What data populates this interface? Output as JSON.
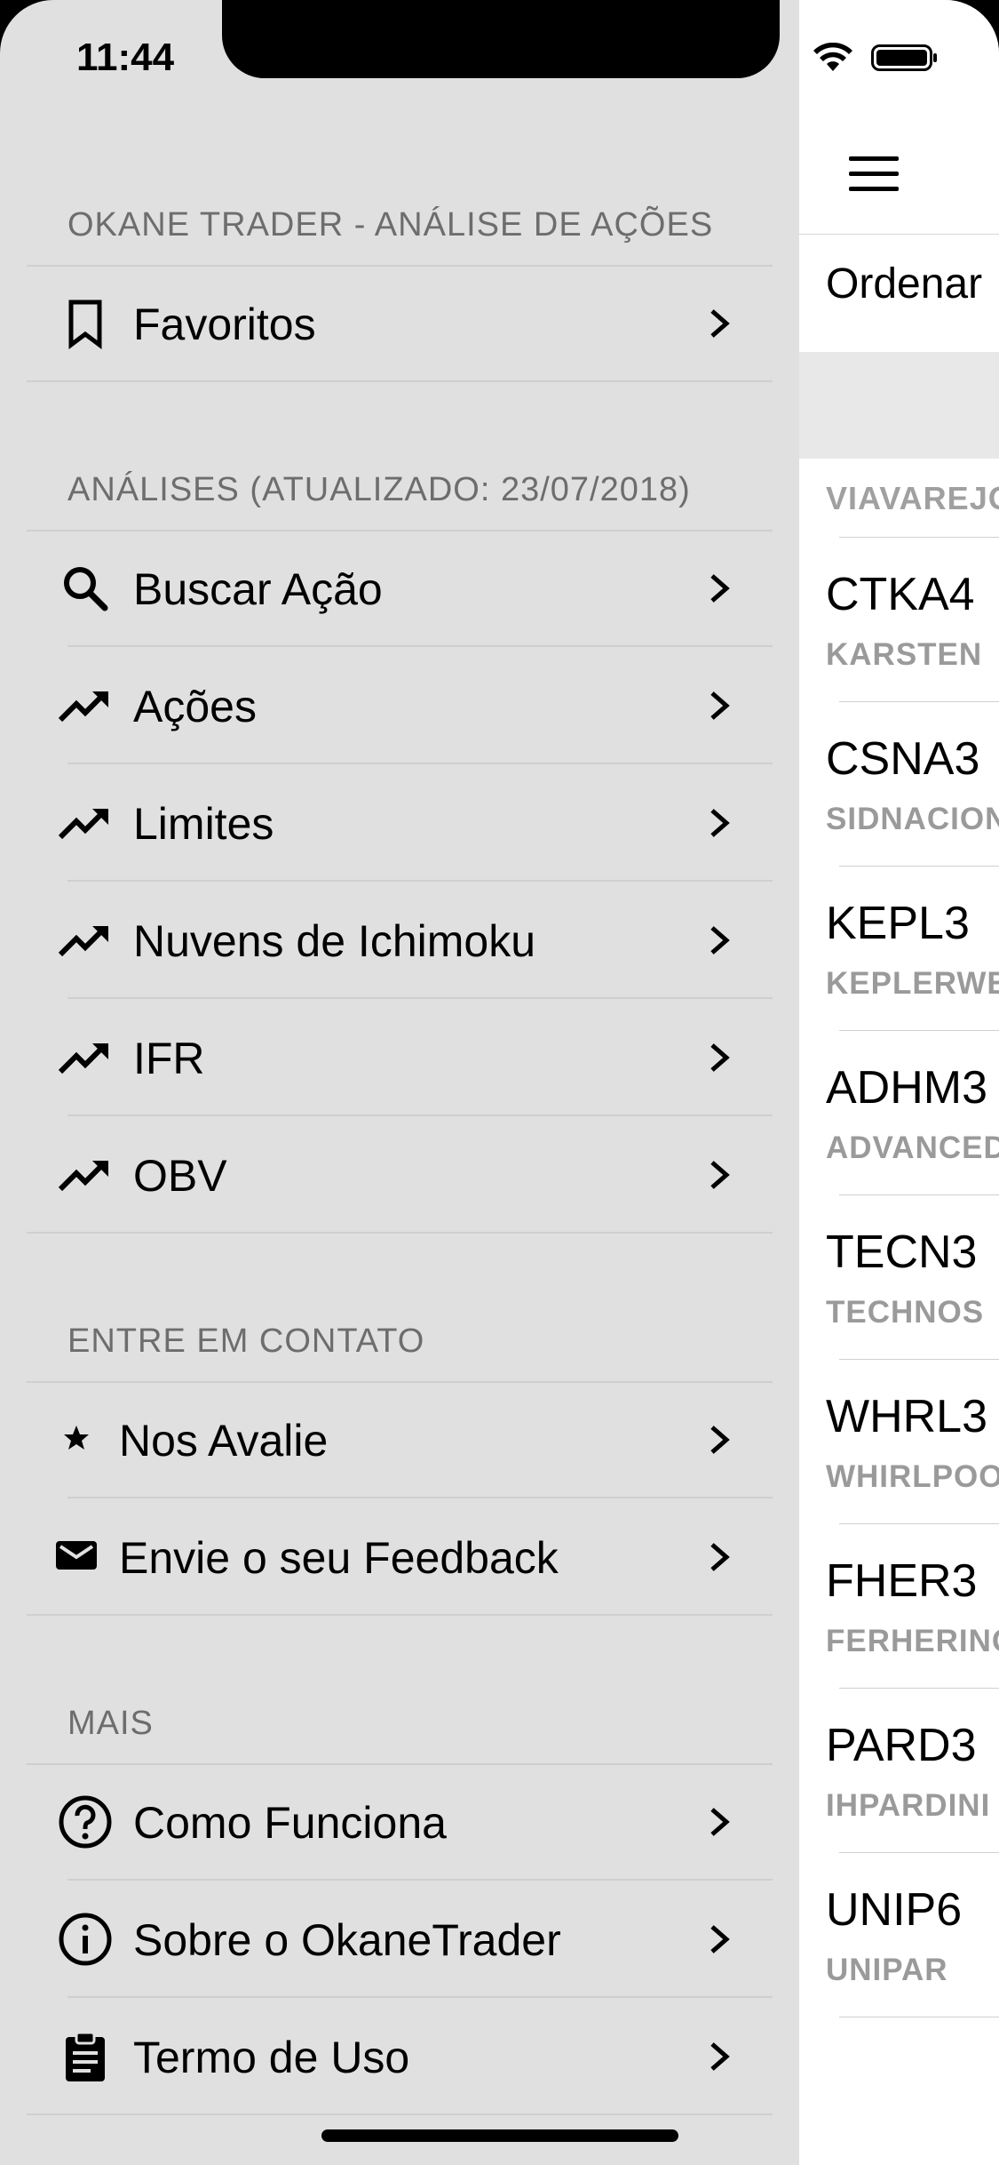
{
  "status_bar": {
    "time": "11:44"
  },
  "main": {
    "sort_label": "Ordenar",
    "list_header": "VIAVAREJO",
    "stocks": [
      {
        "ticker": "CTKA4",
        "name": "KARSTEN"
      },
      {
        "ticker": "CSNA3",
        "name": "SIDNACION"
      },
      {
        "ticker": "KEPL3",
        "name": "KEPLERWE"
      },
      {
        "ticker": "ADHM3",
        "name": "ADVANCED"
      },
      {
        "ticker": "TECN3",
        "name": "TECHNOS"
      },
      {
        "ticker": "WHRL3",
        "name": "WHIRLPOO"
      },
      {
        "ticker": "FHER3",
        "name": "FERHERING"
      },
      {
        "ticker": "PARD3",
        "name": "IHPARDINI"
      },
      {
        "ticker": "UNIP6",
        "name": "UNIPAR"
      }
    ]
  },
  "drawer": {
    "sections": [
      {
        "title": "OKANE TRADER - ANÁLISE DE AÇÕES",
        "items": [
          {
            "label": "Favoritos",
            "icon": "bookmark-icon"
          }
        ]
      },
      {
        "title": "ANÁLISES (ATUALIZADO: 23/07/2018)",
        "items": [
          {
            "label": "Buscar Ação",
            "icon": "search-icon"
          },
          {
            "label": "Ações",
            "icon": "trending-up-icon"
          },
          {
            "label": "Limites",
            "icon": "trending-up-icon"
          },
          {
            "label": "Nuvens de Ichimoku",
            "icon": "trending-up-icon"
          },
          {
            "label": "IFR",
            "icon": "trending-up-icon"
          },
          {
            "label": "OBV",
            "icon": "trending-up-icon"
          }
        ]
      },
      {
        "title": "ENTRE EM CONTATO",
        "items": [
          {
            "label": "Nos Avalie",
            "icon": "star-icon"
          },
          {
            "label": "Envie o seu Feedback",
            "icon": "mail-icon"
          }
        ]
      },
      {
        "title": "MAIS",
        "items": [
          {
            "label": "Como Funciona",
            "icon": "help-circle-icon"
          },
          {
            "label": "Sobre o OkaneTrader",
            "icon": "info-circle-icon"
          },
          {
            "label": "Termo de Uso",
            "icon": "clipboard-icon"
          }
        ]
      }
    ]
  }
}
